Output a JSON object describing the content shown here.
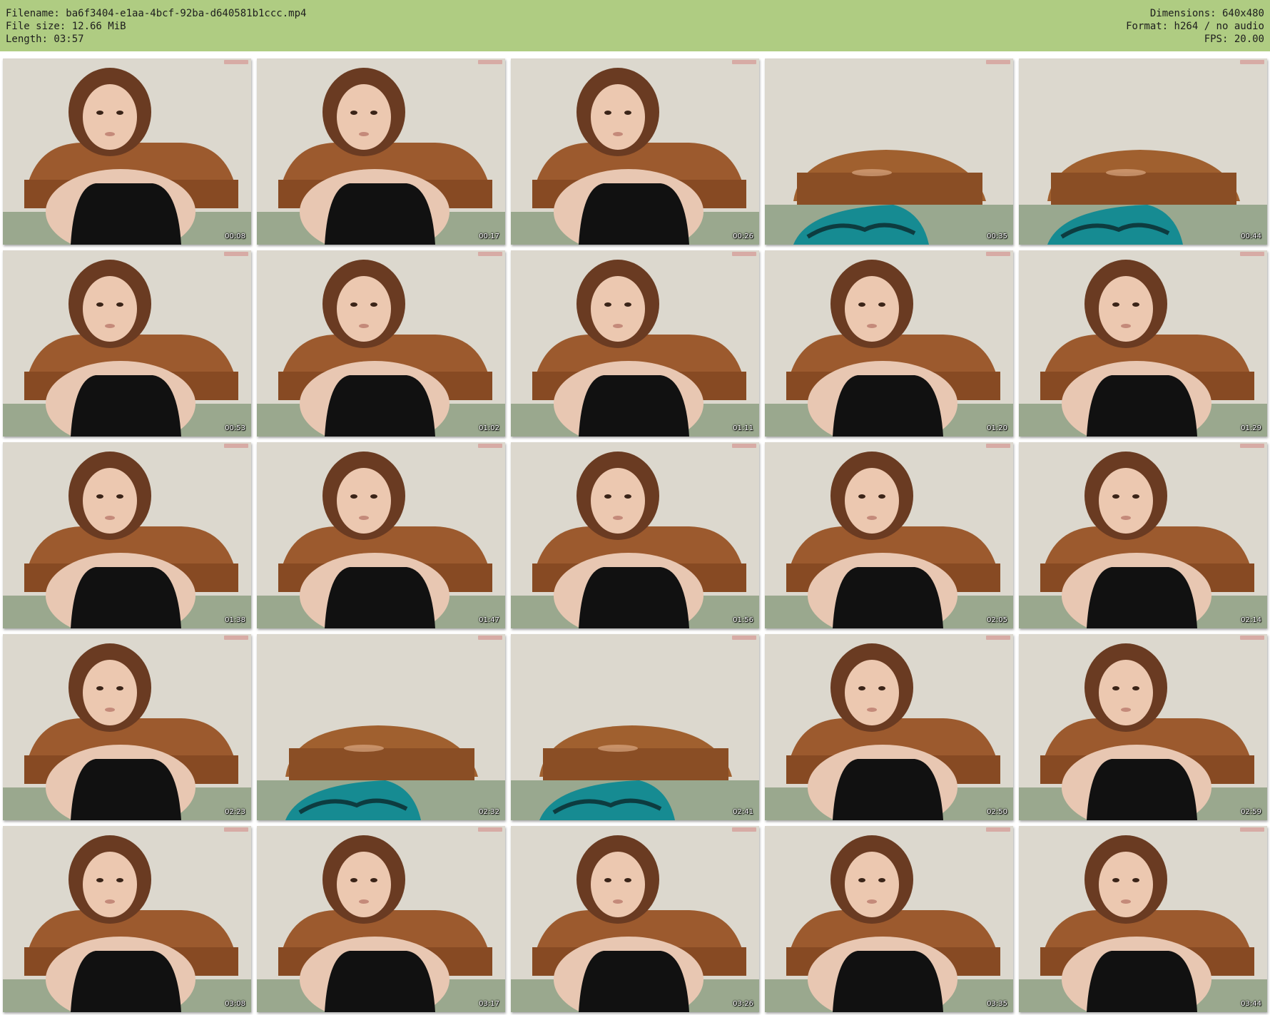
{
  "header": {
    "left": [
      "Filename: ba6f3404-e1aa-4bcf-92ba-d640581b1ccc.mp4",
      "File size: 12.66 MiB",
      "Length: 03:57"
    ],
    "right": [
      "Dimensions: 640x480",
      "Format: h264 / no audio",
      "FPS: 20.00"
    ]
  },
  "thumbnails": [
    {
      "time": "00:08",
      "scene": "person"
    },
    {
      "time": "00:17",
      "scene": "person"
    },
    {
      "time": "00:26",
      "scene": "person"
    },
    {
      "time": "00:35",
      "scene": "bed"
    },
    {
      "time": "00:44",
      "scene": "bed"
    },
    {
      "time": "00:53",
      "scene": "person"
    },
    {
      "time": "01:02",
      "scene": "person"
    },
    {
      "time": "01:11",
      "scene": "person"
    },
    {
      "time": "01:20",
      "scene": "person"
    },
    {
      "time": "01:29",
      "scene": "person"
    },
    {
      "time": "01:38",
      "scene": "person"
    },
    {
      "time": "01:47",
      "scene": "person"
    },
    {
      "time": "01:56",
      "scene": "person"
    },
    {
      "time": "02:05",
      "scene": "person"
    },
    {
      "time": "02:14",
      "scene": "person"
    },
    {
      "time": "02:23",
      "scene": "person"
    },
    {
      "time": "02:32",
      "scene": "bed"
    },
    {
      "time": "02:41",
      "scene": "bed"
    },
    {
      "time": "02:50",
      "scene": "person"
    },
    {
      "time": "02:59",
      "scene": "person"
    },
    {
      "time": "03:08",
      "scene": "person"
    },
    {
      "time": "03:17",
      "scene": "person"
    },
    {
      "time": "03:26",
      "scene": "person"
    },
    {
      "time": "03:35",
      "scene": "person"
    },
    {
      "time": "03:44",
      "scene": "person"
    }
  ]
}
